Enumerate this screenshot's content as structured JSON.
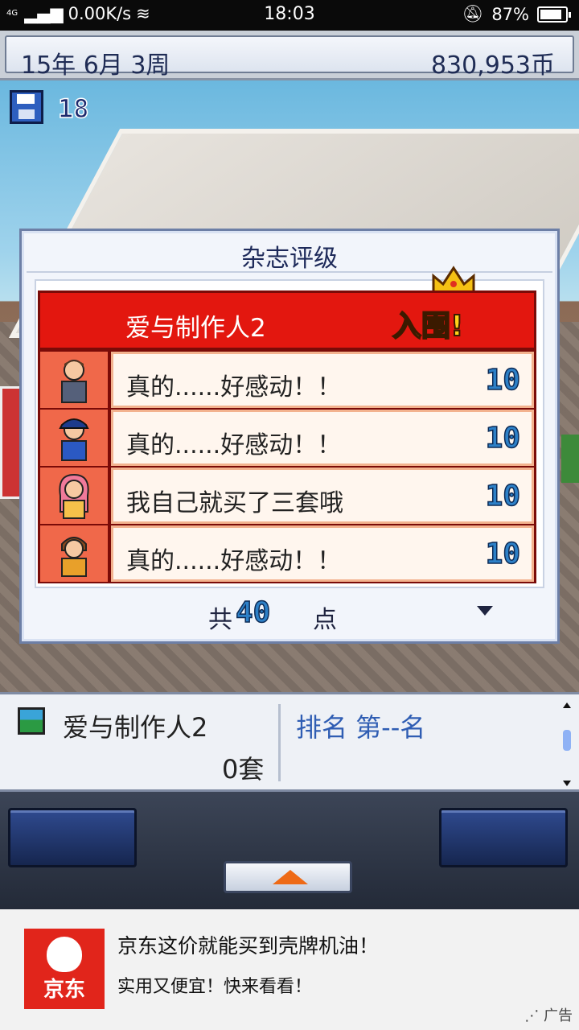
{
  "status_bar": {
    "network": "4G",
    "speed": "0.00K/s",
    "time": "18:03",
    "battery": "87%",
    "battery_level": 0.87
  },
  "top_bar": {
    "date": "15年 6月 3周",
    "money": "830,953币"
  },
  "scene": {
    "save_count": "18"
  },
  "dialog": {
    "title": "杂志评级",
    "game_title": "爱与制作人2",
    "stamp": "入围!",
    "reviews": [
      {
        "quote": "真的......好感动！！",
        "score": "10"
      },
      {
        "quote": "真的......好感动！！",
        "score": "10"
      },
      {
        "quote": "我自己就买了三套哦",
        "score": "10"
      },
      {
        "quote": "真的......好感动！！",
        "score": "10"
      }
    ],
    "total_label": "共",
    "total_value": "40",
    "total_unit": "点"
  },
  "info_panel": {
    "game_name": "爱与制作人2",
    "units_sold": "0套",
    "rank": "排名 第--名"
  },
  "ad": {
    "brand": "京东",
    "headline": "京东这价就能买到壳牌机油！",
    "subline": "实用又便宜！快来看看！",
    "tag": "广告"
  }
}
